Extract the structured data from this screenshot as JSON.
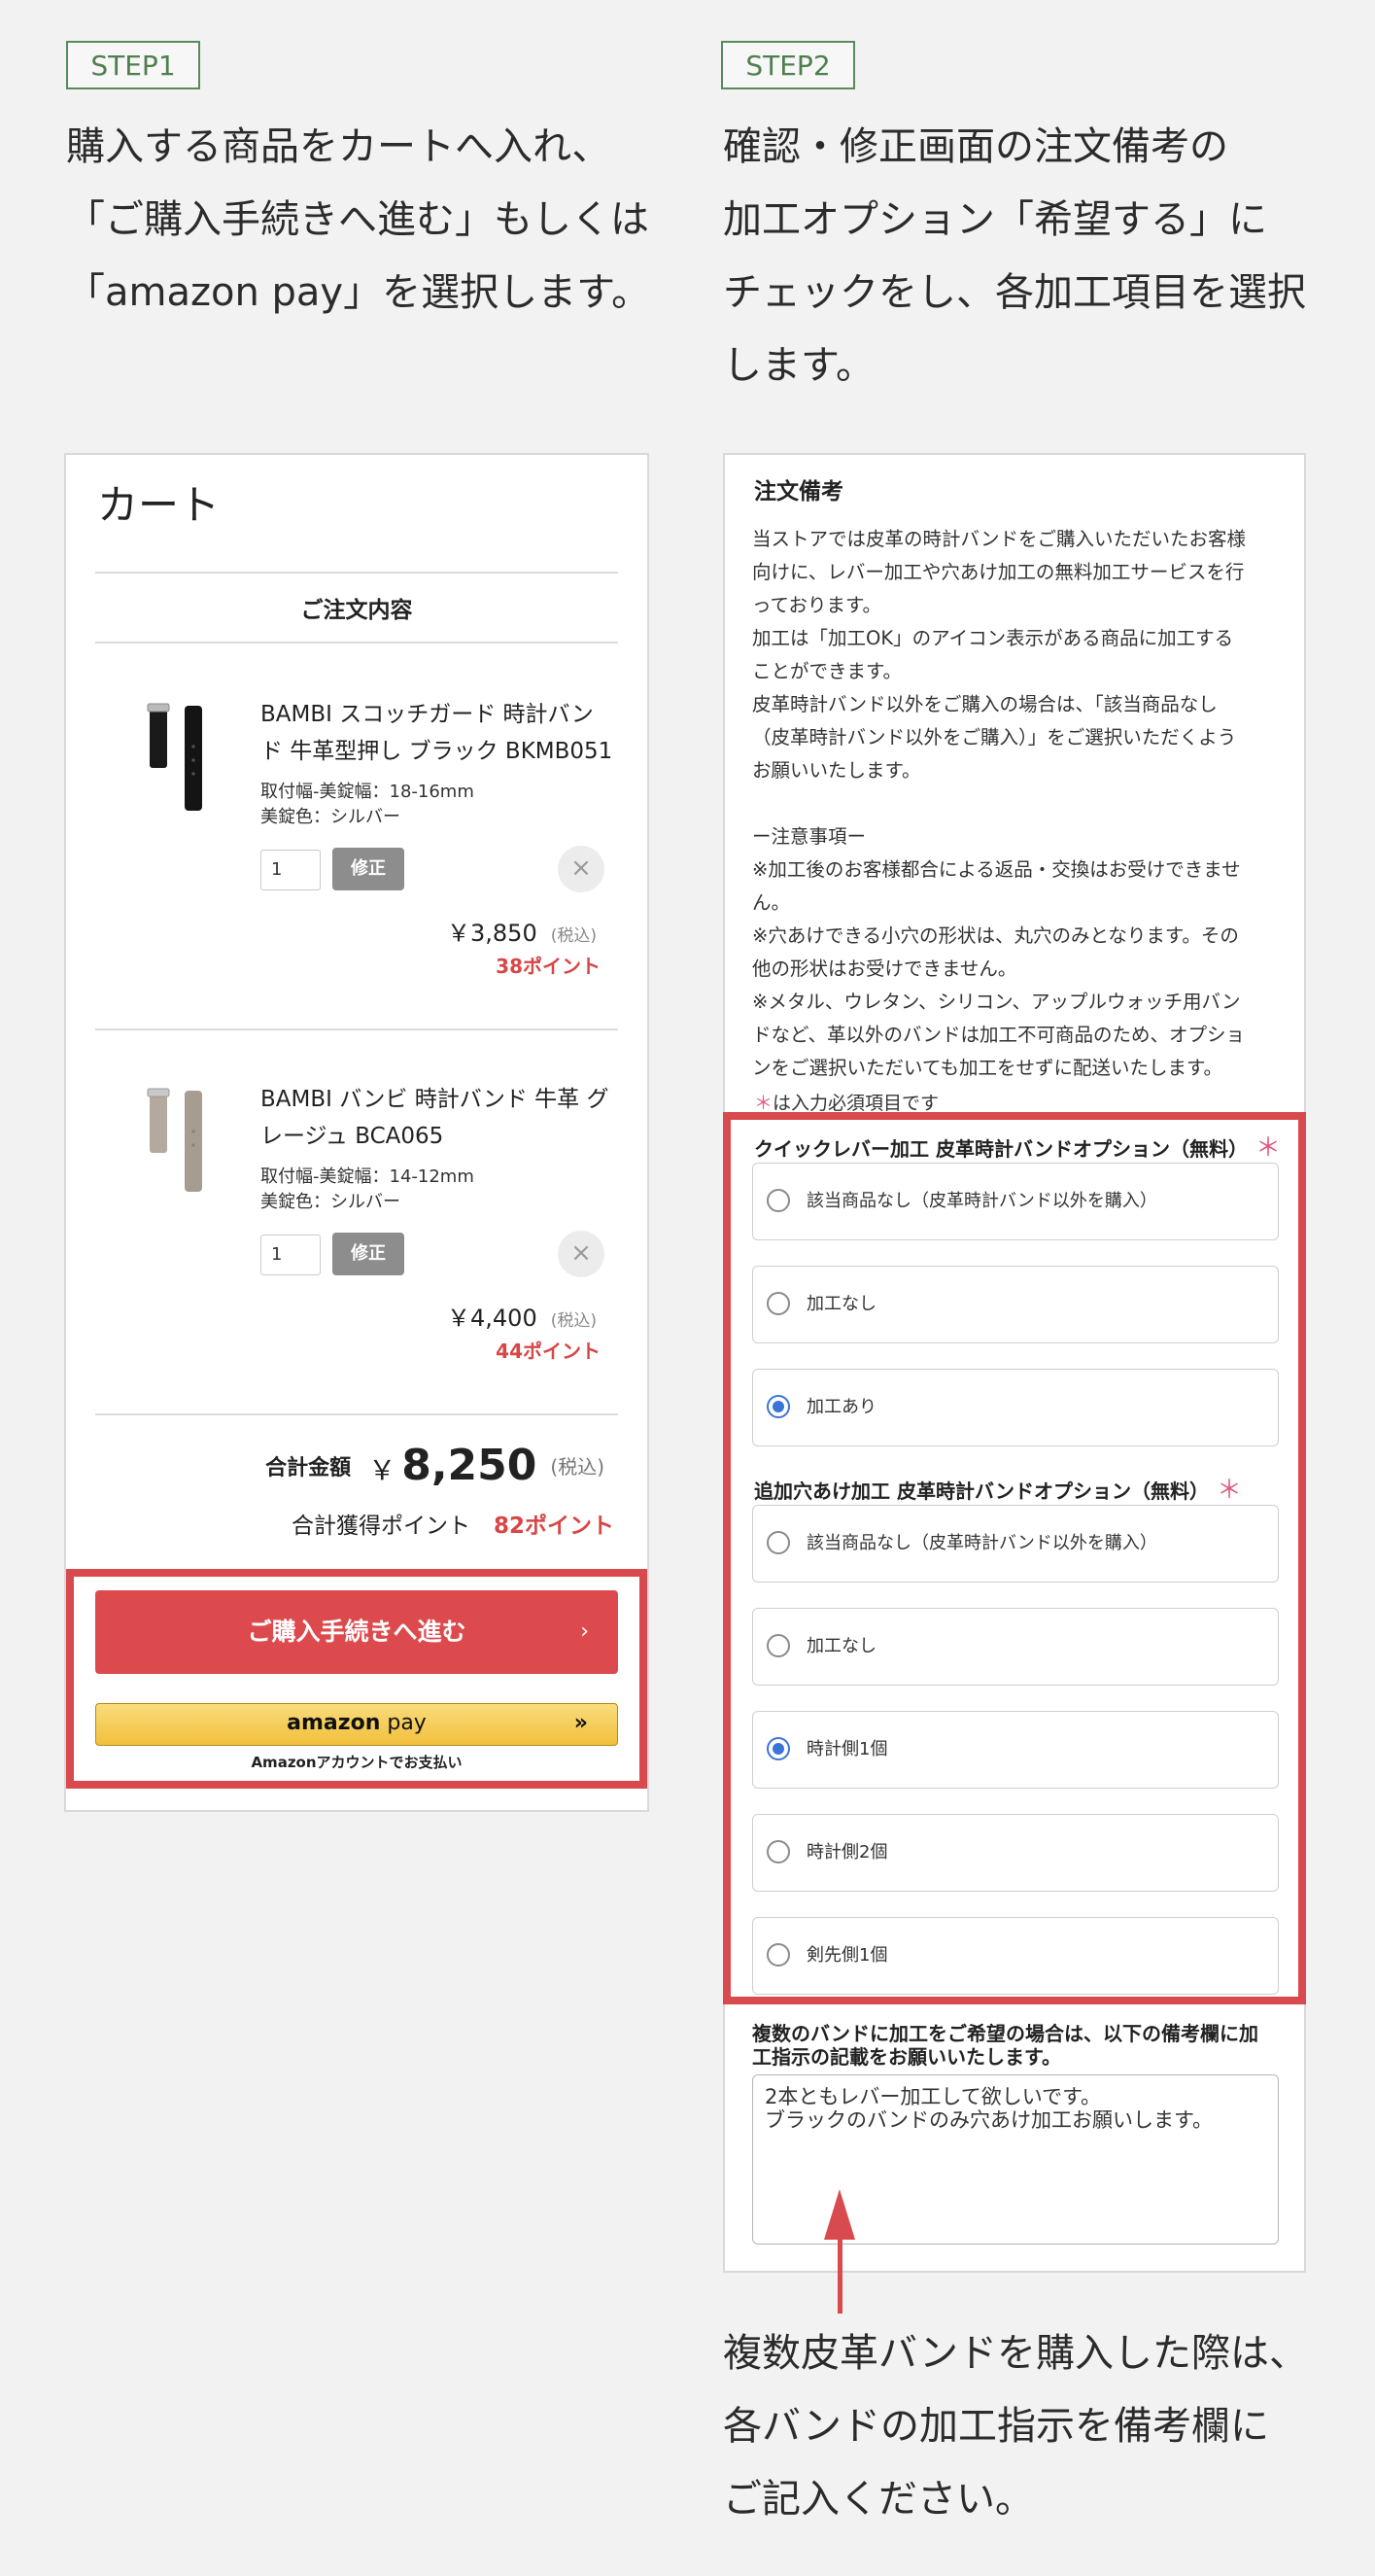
{
  "colors": {
    "accent_red": "#d94a4e",
    "step_green": "#4f7f4f",
    "amazon_yellow": "#f2bf3b",
    "radio_blue": "#3b74d8"
  },
  "step1": {
    "badge": "STEP1",
    "lines": [
      "購入する商品をカートへ入れ、",
      "「ご購入手続きへ進む」もしくは",
      "「amazon pay」を選択します。"
    ]
  },
  "step2": {
    "badge": "STEP2",
    "lines": [
      "確認・修正画面の注文備考の",
      "加工オプション「希望する」に",
      "チェックをし、各加工項目を選択",
      "します。"
    ]
  },
  "cart": {
    "title": "カート",
    "order_heading": "ご注文内容",
    "items": [
      {
        "name_lines": [
          "BAMBI スコッチガード 時計バン",
          "ド 牛革型押し ブラック BKMB051"
        ],
        "width": "取付幅-美錠幅：18-16mm",
        "color": "美錠色：シルバー",
        "qty": "1",
        "fix_label": "修正",
        "remove_icon": "×",
        "price": "￥3,850",
        "tax": "(税込)",
        "points": "38ポイント"
      },
      {
        "name_lines": [
          "BAMBI バンビ 時計バンド 牛革 グ",
          "レージュ BCA065"
        ],
        "width": "取付幅-美錠幅：14-12mm",
        "color": "美錠色：シルバー",
        "qty": "1",
        "fix_label": "修正",
        "remove_icon": "×",
        "price": "￥4,400",
        "tax": "(税込)",
        "points": "44ポイント"
      }
    ],
    "total_label": "合計金額",
    "total_yen": "￥",
    "total_value": "8,250",
    "total_tax": "(税込)",
    "earn_label": "合計獲得ポイント",
    "earn_points": "82ポイント",
    "checkout_label": "ご購入手続きへ進む",
    "checkout_chevron": "›",
    "amazon_logo_a": "amazon",
    "amazon_logo_b": " pay",
    "amazon_arrows": "»",
    "amazon_note": "Amazonアカウントでお支払い"
  },
  "memo": {
    "title": "注文備考",
    "paragraphs": [
      [
        "当ストアでは皮革の時計バンドをご購入いただいたお客様",
        "向けに、レバー加工や穴あけ加工の無料加工サービスを行",
        "っております。"
      ],
      [
        "加工は「加工OK」のアイコン表示がある商品に加工する",
        "ことができます。"
      ],
      [
        "皮革時計バンド以外をご購入の場合は、「該当商品なし",
        "（皮革時計バンド以外をご購入）」をご選択いただくよう",
        "お願いいたします。"
      ]
    ],
    "notice_title": "ー注意事項ー",
    "notices": [
      [
        "※加工後のお客様都合による返品・交換はお受けできませ",
        "ん。"
      ],
      [
        "※穴あけできる小穴の形状は、丸穴のみとなります。その",
        "他の形状はお受けできません。"
      ],
      [
        "※メタル、ウレタン、シリコン、アップルウォッチ用バン",
        "ドなど、革以外のバンドは加工不可商品のため、オプショ",
        "ンをご選択いただいても加工をせずに配送いたします。"
      ]
    ],
    "required_star": "＊",
    "required_note": "は入力必須項目です",
    "group1": {
      "title": "クイックレバー加工 皮革時計バンドオプション（無料）",
      "options": [
        "該当商品なし（皮革時計バンド以外を購入）",
        "加工なし",
        "加工あり"
      ],
      "selected": 2
    },
    "group2": {
      "title": "追加穴あけ加工 皮革時計バンドオプション（無料）",
      "options": [
        "該当商品なし（皮革時計バンド以外を購入）",
        "加工なし",
        "時計側1個",
        "時計側2個",
        "剣先側1個"
      ],
      "selected": 2
    },
    "multi_title_lines": [
      "複数のバンドに加工をご希望の場合は、以下の備考欄に加",
      "工指示の記載をお願いいたします。"
    ],
    "memo_lines": [
      "2本ともレバー加工して欲しいです。",
      "ブラックのバンドのみ穴あけ加工お願いします。"
    ]
  },
  "bottom_note": [
    "複数皮革バンドを購入した際は、",
    "各バンドの加工指示を備考欄に",
    "ご記入ください。"
  ]
}
